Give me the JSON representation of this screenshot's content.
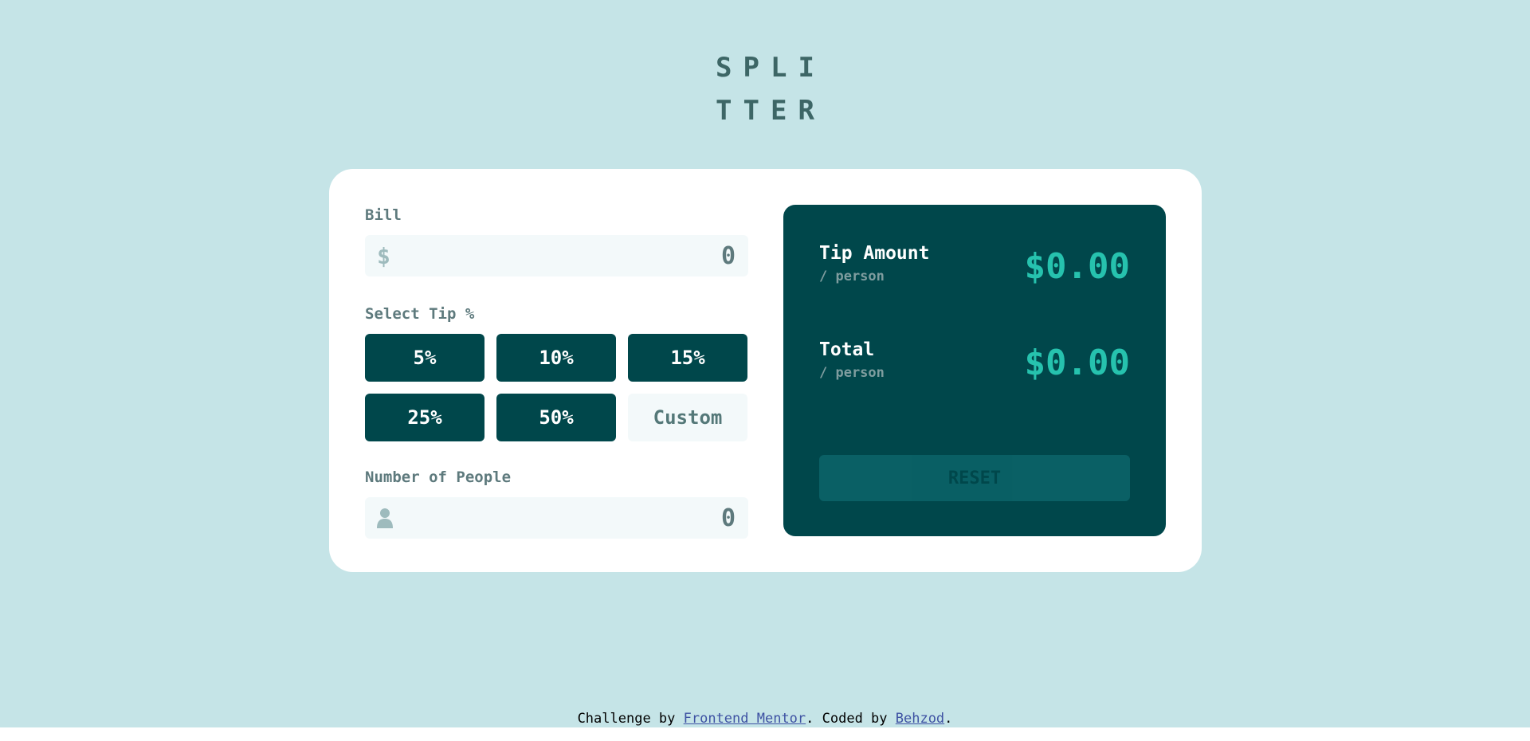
{
  "logo": {
    "line1": "SPLI",
    "line2": "TTER"
  },
  "bill": {
    "label": "Bill",
    "currency_symbol": "$",
    "value": "0"
  },
  "tip": {
    "label": "Select Tip %",
    "options": [
      "5%",
      "10%",
      "15%",
      "25%",
      "50%"
    ],
    "custom_placeholder": "Custom"
  },
  "people": {
    "label": "Number of People",
    "icon": "person-icon",
    "value": "0"
  },
  "results": {
    "tip_amount": {
      "title": "Tip Amount",
      "sub": "/ person",
      "value": "$0.00"
    },
    "total": {
      "title": "Total",
      "sub": "/ person",
      "value": "$0.00"
    },
    "reset_label": "RESET"
  },
  "footer": {
    "prefix": "Challenge by ",
    "link1": "Frontend Mentor",
    "middle": ". Coded by ",
    "link2": "Behzod",
    "suffix": "."
  },
  "colors": {
    "background": "#c5e4e7",
    "dark_cyan": "#00474b",
    "accent": "#26c2ae",
    "input_bg": "#f3f9fa"
  }
}
